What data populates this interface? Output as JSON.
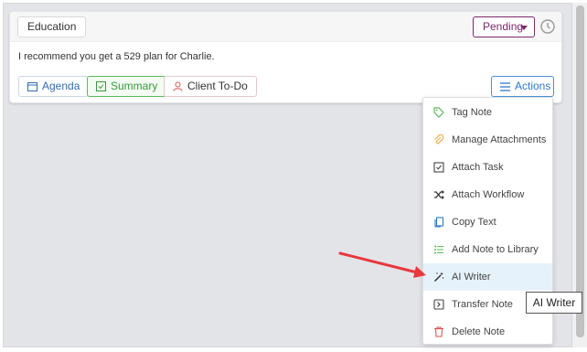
{
  "note": {
    "category": "Education",
    "status": "Pending",
    "text": "I recommend you get a 529 plan for Charlie."
  },
  "footer_buttons": {
    "agenda": "Agenda",
    "summary": "Summary",
    "client_todo": "Client To-Do",
    "actions": "Actions"
  },
  "menu": {
    "items": [
      {
        "label": "Tag Note",
        "icon": "tag-icon"
      },
      {
        "label": "Manage Attachments",
        "icon": "paperclip-icon"
      },
      {
        "label": "Attach Task",
        "icon": "checkbox-icon"
      },
      {
        "label": "Attach Workflow",
        "icon": "shuffle-icon"
      },
      {
        "label": "Copy Text",
        "icon": "copy-icon"
      },
      {
        "label": "Add Note to Library",
        "icon": "list-icon"
      },
      {
        "label": "AI Writer",
        "icon": "magic-wand-icon"
      },
      {
        "label": "Transfer Note",
        "icon": "transfer-icon"
      },
      {
        "label": "Delete Note",
        "icon": "trash-icon"
      }
    ]
  },
  "tooltip": "AI Writer",
  "colors": {
    "status": "#7b2a6b",
    "actions": "#2f78c6",
    "summary": "#3a9a3a",
    "hover_bg": "#e6f2fb",
    "arrow": "#e8383d"
  }
}
